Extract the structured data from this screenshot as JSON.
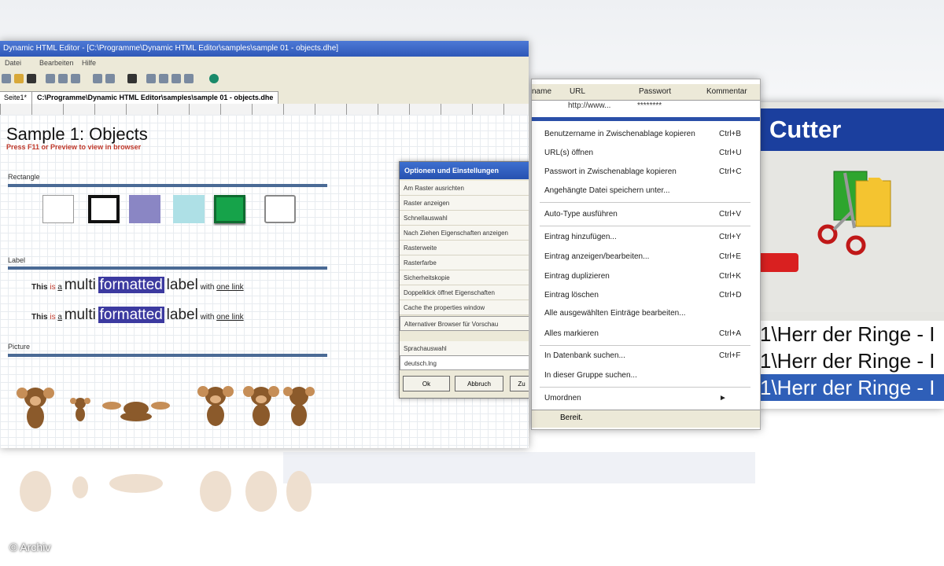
{
  "cutter": {
    "title": "Cutter",
    "rows": [
      "1\\Herr der Ringe - I",
      "1\\Herr der Ringe - I",
      "1\\Herr der Ringe - I"
    ],
    "colors": {
      "title": "#1b3f9e",
      "selection": "#2f5fb8",
      "accent": "#d92020"
    }
  },
  "context": {
    "columns": {
      "name": "name",
      "url": "URL",
      "password": "Passwort",
      "comment": "Kommentar"
    },
    "url_value": "http://www...",
    "password_value": "********",
    "items": [
      {
        "label": "Benutzername in Zwischenablage kopieren",
        "key": "Ctrl+B"
      },
      {
        "label": "URL(s) öffnen",
        "key": "Ctrl+U"
      },
      {
        "label": "Passwort in Zwischenablage kopieren",
        "key": "Ctrl+C"
      },
      {
        "label": "Angehängte Datei speichern unter...",
        "key": ""
      },
      {
        "label": "Auto-Type ausführen",
        "key": "Ctrl+V"
      },
      {
        "label": "Eintrag hinzufügen...",
        "key": "Ctrl+Y"
      },
      {
        "label": "Eintrag anzeigen/bearbeiten...",
        "key": "Ctrl+E"
      },
      {
        "label": "Eintrag duplizieren",
        "key": "Ctrl+K"
      },
      {
        "label": "Eintrag löschen",
        "key": "Ctrl+D"
      },
      {
        "label": "Alle ausgewählten Einträge bearbeiten...",
        "key": ""
      },
      {
        "label": "Alles markieren",
        "key": "Ctrl+A"
      },
      {
        "label": "In Datenbank suchen...",
        "key": "Ctrl+F"
      },
      {
        "label": "In dieser Gruppe suchen...",
        "key": ""
      },
      {
        "label": "Umordnen",
        "key": "►"
      }
    ],
    "status": "Bereit."
  },
  "editor": {
    "title": "Dynamic HTML Editor - [C:\\Programme\\Dynamic HTML Editor\\samples\\sample 01 - objects.dhe]",
    "menu": [
      "Datei",
      "Bearbeiten",
      "Hilfe"
    ],
    "tabs": [
      "Seite1*",
      "C:\\Programme\\Dynamic HTML Editor\\samples\\sample 01 - objects.dhe"
    ],
    "heading": "Sample 1: Objects",
    "hint": "Press F11 or Preview to view in browser",
    "sections": {
      "rectangle": "Rectangle",
      "label": "Label",
      "picture": "Picture"
    },
    "rect_colors": [
      "#ffffff",
      "#ffffff",
      "#8a86c4",
      "#aee0e6",
      "#16a34a",
      "#ffffff"
    ],
    "label_line": {
      "this": "This",
      "is": "is",
      "a": "a",
      "multi": "multi",
      "formatted": "formatted",
      "label": "label",
      "with": "with",
      "link": "one link"
    }
  },
  "dialog": {
    "title": "Optionen und Einstellungen",
    "options": [
      "Am Raster ausrichten",
      "Raster anzeigen",
      "Schnellauswahl",
      "Nach Ziehen Eigenschaften anzeigen",
      "Rasterweite",
      "Rasterfarbe",
      "Sicherheitskopie",
      "Doppelklick öffnet Eigenschaften",
      "Cache the properties window",
      "Alternativer Browser für Vorschau"
    ],
    "field_label": "Sprachauswahl",
    "field_value": "deutsch.lng",
    "ok": "Ok",
    "cancel": "Abbruch",
    "third": "Zu"
  },
  "copyright": "© Archiv"
}
